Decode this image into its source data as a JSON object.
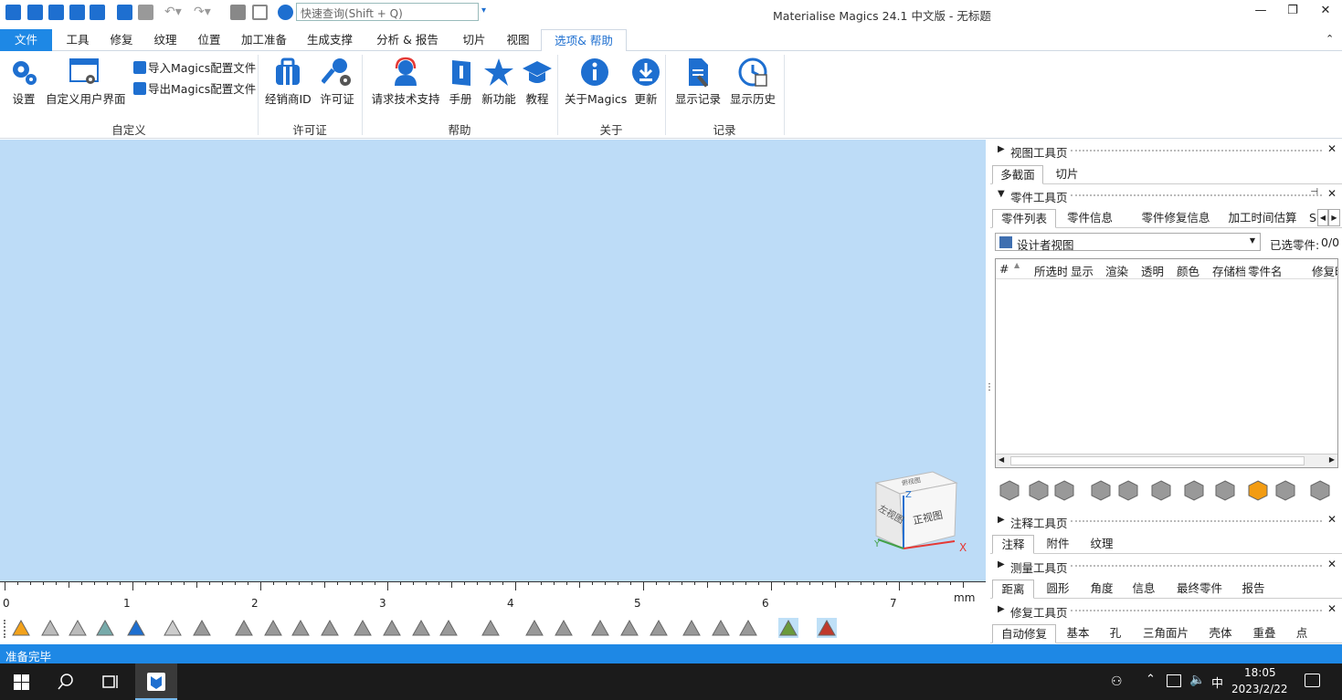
{
  "window": {
    "title": "Materialise Magics 24.1 中文版 - 无标题"
  },
  "search": {
    "placeholder": "快速查询(Shift + Q)"
  },
  "tabs": [
    "文件",
    "工具",
    "修复",
    "纹理",
    "位置",
    "加工准备",
    "生成支撑",
    "分析 & 报告",
    "切片",
    "视图",
    "选项& 帮助"
  ],
  "ribbon": {
    "customize": {
      "settings": "设置",
      "custom_ui": "自定义用户界面",
      "import_cfg": "导入Magics配置文件",
      "export_cfg": "导出Magics配置文件",
      "group": "自定义"
    },
    "license": {
      "reseller": "经销商ID",
      "license": "许可证",
      "group": "许可证"
    },
    "help": {
      "support": "请求技术支持",
      "manual": "手册",
      "new": "新功能",
      "tutorial": "教程",
      "group": "帮助"
    },
    "about": {
      "about": "关于Magics",
      "update": "更新",
      "group": "关于"
    },
    "log": {
      "show_log": "显示记录",
      "show_history": "显示历史",
      "group": "记录"
    }
  },
  "viewcube": {
    "top": "俯视图",
    "left": "左视图",
    "front": "正视图",
    "axis_z": "Z",
    "axis_y": "Y",
    "axis_x": "X"
  },
  "ruler": {
    "ticks": [
      "0",
      "1",
      "2",
      "3",
      "4",
      "5",
      "6",
      "7"
    ],
    "unit": "mm"
  },
  "panels": {
    "view": {
      "title": "视图工具页",
      "tabs": [
        "多截面",
        "切片"
      ]
    },
    "part": {
      "title": "零件工具页",
      "tabs": [
        "零件列表",
        "零件信息",
        "零件修复信息",
        "加工时间估算",
        "S"
      ],
      "view_select": "设计者视图",
      "selected_label": "已选零件:",
      "selected_count": "0/0",
      "columns": [
        "#",
        "所选时",
        "显示",
        "渲染",
        "透明",
        "颜色",
        "存储档",
        "零件名",
        "修复时"
      ]
    },
    "annot": {
      "title": "注释工具页",
      "tabs": [
        "注释",
        "附件",
        "纹理"
      ]
    },
    "measure": {
      "title": "测量工具页",
      "tabs": [
        "距离",
        "圆形",
        "角度",
        "信息",
        "最终零件",
        "报告"
      ]
    },
    "repair": {
      "title": "修复工具页",
      "tabs": [
        "自动修复",
        "基本",
        "孔",
        "三角面片",
        "壳体",
        "重叠",
        "点"
      ]
    }
  },
  "status": {
    "text": "准备完毕"
  },
  "taskbar": {
    "time": "18:05",
    "date": "2023/2/22",
    "ime": "中"
  }
}
